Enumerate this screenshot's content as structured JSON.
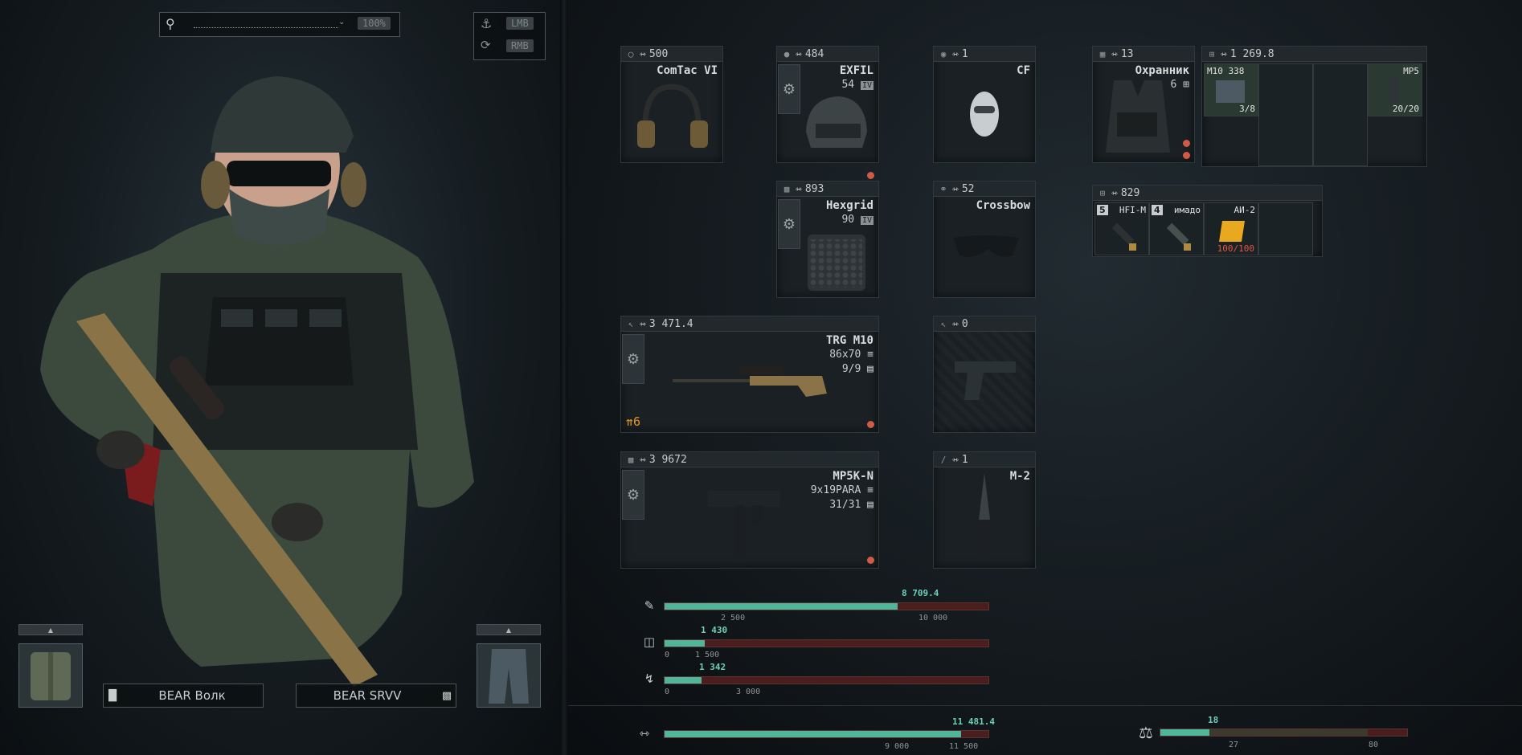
{
  "search": {
    "zoom": "100%"
  },
  "hints": {
    "lmb": "LMB",
    "rmb": "RMB"
  },
  "buttons": {
    "top_clothing": "BEAR Волк",
    "bottom_clothing": "BEAR SRVV"
  },
  "slots": {
    "earpiece": {
      "weight": "500",
      "name": "ComTac VI"
    },
    "headwear": {
      "weight": "484",
      "name": "EXFIL",
      "durability": "54",
      "armor_class": "IV"
    },
    "face_cover": {
      "weight": "1",
      "name": "CF"
    },
    "tactical_rig": {
      "weight": "13",
      "name": "Охранник",
      "slots": "6"
    },
    "backpack": {
      "weight": "1 269.8",
      "items": [
        {
          "name": "M10 338",
          "count": "3/8"
        },
        {
          "name": "MP5",
          "count": "20/20"
        }
      ]
    },
    "body_armor": {
      "weight": "893",
      "name": "Hexgrid",
      "durability": "90",
      "armor_class": "IV"
    },
    "eyewear": {
      "weight": "52",
      "name": "Crossbow"
    },
    "pockets": {
      "weight": "829",
      "items": [
        {
          "badge": "5",
          "name": "HFI-M"
        },
        {
          "badge": "4",
          "name": "имадо"
        },
        {
          "name": "АИ-2",
          "count": "100/100"
        }
      ]
    },
    "primary": {
      "weight": "3 471.4",
      "name": "TRG M10",
      "caliber": "86x70",
      "ammo": "9/9",
      "level": "6"
    },
    "holster": {
      "weight": "0"
    },
    "secondary": {
      "weight": "3 9672",
      "name": "MP5K-N",
      "caliber": "9x19PARA",
      "ammo": "31/31"
    },
    "scabbard": {
      "weight": "1",
      "name": "M-2"
    }
  },
  "stats": {
    "value": {
      "current": "8 709.4",
      "tick1": "2 500",
      "tick2": "10 000",
      "fraction": 0.72
    },
    "armor": {
      "current": "1 430",
      "tick0": "0",
      "tick1": "1 500",
      "fraction": 0.125
    },
    "energy": {
      "current": "1 342",
      "tick0": "0",
      "tick1": "3 000",
      "fraction": 0.115
    },
    "total": {
      "current": "11 481.4",
      "tick1": "9 000",
      "tick2": "11 500",
      "fraction": 0.915
    },
    "weight": {
      "current": "18",
      "tick1": "27",
      "tick2": "80",
      "fraction": 0.2
    }
  },
  "colors": {
    "accent": "#4fb69a",
    "bar_bg": "#4a1e1c",
    "warn": "#e7962a",
    "bad": "#e0563e"
  }
}
